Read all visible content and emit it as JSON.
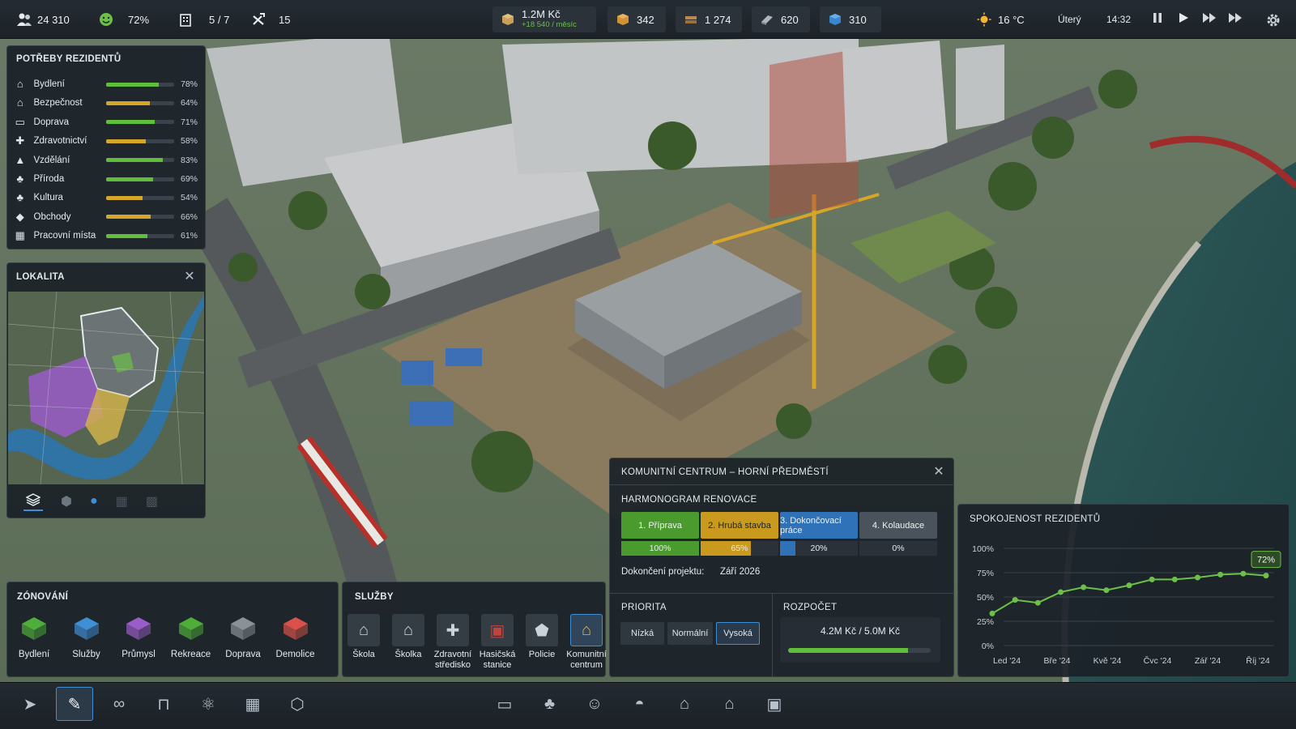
{
  "topbar": {
    "population": "24 310",
    "happiness": "72%",
    "buildings": "5 / 7",
    "workers": "15",
    "money": "1.2M Kč",
    "money_delta": "+18 540 / měsíc",
    "res1": "342",
    "res2": "1 274",
    "res3": "620",
    "res4": "310",
    "temperature": "16 °C",
    "day": "Úterý",
    "time": "14:32"
  },
  "needs": {
    "title": "POTŘEBY REZIDENTŮ",
    "items": [
      {
        "label": "Bydlení",
        "value": "78%",
        "level": 0.78,
        "color": "#5fbf3a"
      },
      {
        "label": "Bezpečnost",
        "value": "64%",
        "level": 0.64,
        "color": "#d6a628"
      },
      {
        "label": "Doprava",
        "value": "71%",
        "level": 0.71,
        "color": "#5fbf3a"
      },
      {
        "label": "Zdravotnictví",
        "value": "58%",
        "level": 0.58,
        "color": "#d6a628"
      },
      {
        "label": "Vzdělání",
        "value": "83%",
        "level": 0.83,
        "color": "#5fbf3a"
      },
      {
        "label": "Příroda",
        "value": "69%",
        "level": 0.69,
        "color": "#5fbf3a"
      },
      {
        "label": "Kultura",
        "value": "54%",
        "level": 0.54,
        "color": "#d6a628"
      },
      {
        "label": "Obchody",
        "value": "66%",
        "level": 0.66,
        "color": "#d6a628"
      },
      {
        "label": "Pracovní místa",
        "value": "61%",
        "level": 0.61,
        "color": "#5fbf3a"
      }
    ]
  },
  "locality": {
    "title": "LOKALITA"
  },
  "zoning": {
    "title": "ZÓNOVÁNÍ",
    "items": [
      {
        "label": "Bydlení",
        "color": "#4fae3a"
      },
      {
        "label": "Služby",
        "color": "#3f8fd6"
      },
      {
        "label": "Průmysl",
        "color": "#9a5cc8"
      },
      {
        "label": "Rekreace",
        "color": "#4fae3a"
      },
      {
        "label": "Doprava",
        "color": "#8a9298"
      },
      {
        "label": "Demolice",
        "color": "#d9524a"
      }
    ]
  },
  "services": {
    "title": "SLUŽBY",
    "items": [
      {
        "label": "Škola",
        "icon": "school-icon"
      },
      {
        "label": "Školka",
        "icon": "kindergarten-icon"
      },
      {
        "label": "Zdravotní středisko",
        "icon": "health-center-icon"
      },
      {
        "label": "Hasičská stanice",
        "icon": "fire-station-icon"
      },
      {
        "label": "Policie",
        "icon": "police-icon"
      },
      {
        "label": "Komunitní centrum",
        "icon": "community-center-icon"
      }
    ]
  },
  "project": {
    "title": "KOMUNITNÍ CENTRUM – HORNÍ PŘEDMĚSTÍ",
    "schedule_title": "HARMONOGRAM RENOVACE",
    "stages": [
      {
        "label": "1. Příprava",
        "value": "100%",
        "level": 1.0,
        "color": "#4a9a2e"
      },
      {
        "label": "2. Hrubá stavba",
        "value": "65%",
        "level": 0.65,
        "color": "#c99a1e"
      },
      {
        "label": "3. Dokončovací práce",
        "value": "20%",
        "level": 0.2,
        "color": "#2f72b8"
      },
      {
        "label": "4. Kolaudace",
        "value": "0%",
        "level": 0.0,
        "color": "#4a535b"
      }
    ],
    "completion_label": "Dokončení projektu:",
    "completion_value": "Září 2026",
    "priority_title": "PRIORITA",
    "priority_options": [
      "Nízká",
      "Normální",
      "Vysoká"
    ],
    "priority_selected": "Vysoká",
    "budget_title": "ROZPOČET",
    "budget_value": "4.2M Kč / 5.0M Kč",
    "budget_level": 0.84
  },
  "satisfaction": {
    "title": "SPOKOJENOST REZIDENTŮ",
    "current_badge": "72%"
  },
  "chart_data": {
    "type": "line",
    "title": "SPOKOJENOST REZIDENTŮ",
    "xlabel": "",
    "ylabel": "",
    "x_ticks": [
      "Led '24",
      "Bře '24",
      "Kvě '24",
      "Čvc '24",
      "Zář '24",
      "Říj '24"
    ],
    "y_ticks": [
      "100%",
      "75%",
      "50%",
      "25%",
      "0%"
    ],
    "ylim": [
      0,
      100
    ],
    "grid": true,
    "series": [
      {
        "values": [
          33,
          47,
          44,
          55,
          60,
          57,
          62,
          68,
          68,
          70,
          73,
          74,
          72
        ]
      }
    ]
  },
  "toolbar": {
    "left_tools": [
      "select-icon",
      "brush-icon",
      "link-icon",
      "bench-icon",
      "molecule-icon",
      "building-icon",
      "cube-frame-icon"
    ],
    "center_tools": [
      "sign-icon",
      "tree-icon",
      "crowd-icon",
      "dome-icon",
      "houses-icon",
      "school-building-icon",
      "box-icon"
    ]
  },
  "colors": {
    "accent_blue": "#3f8fd6",
    "accent_green": "#5fbf3a",
    "accent_yellow": "#d6a628"
  }
}
